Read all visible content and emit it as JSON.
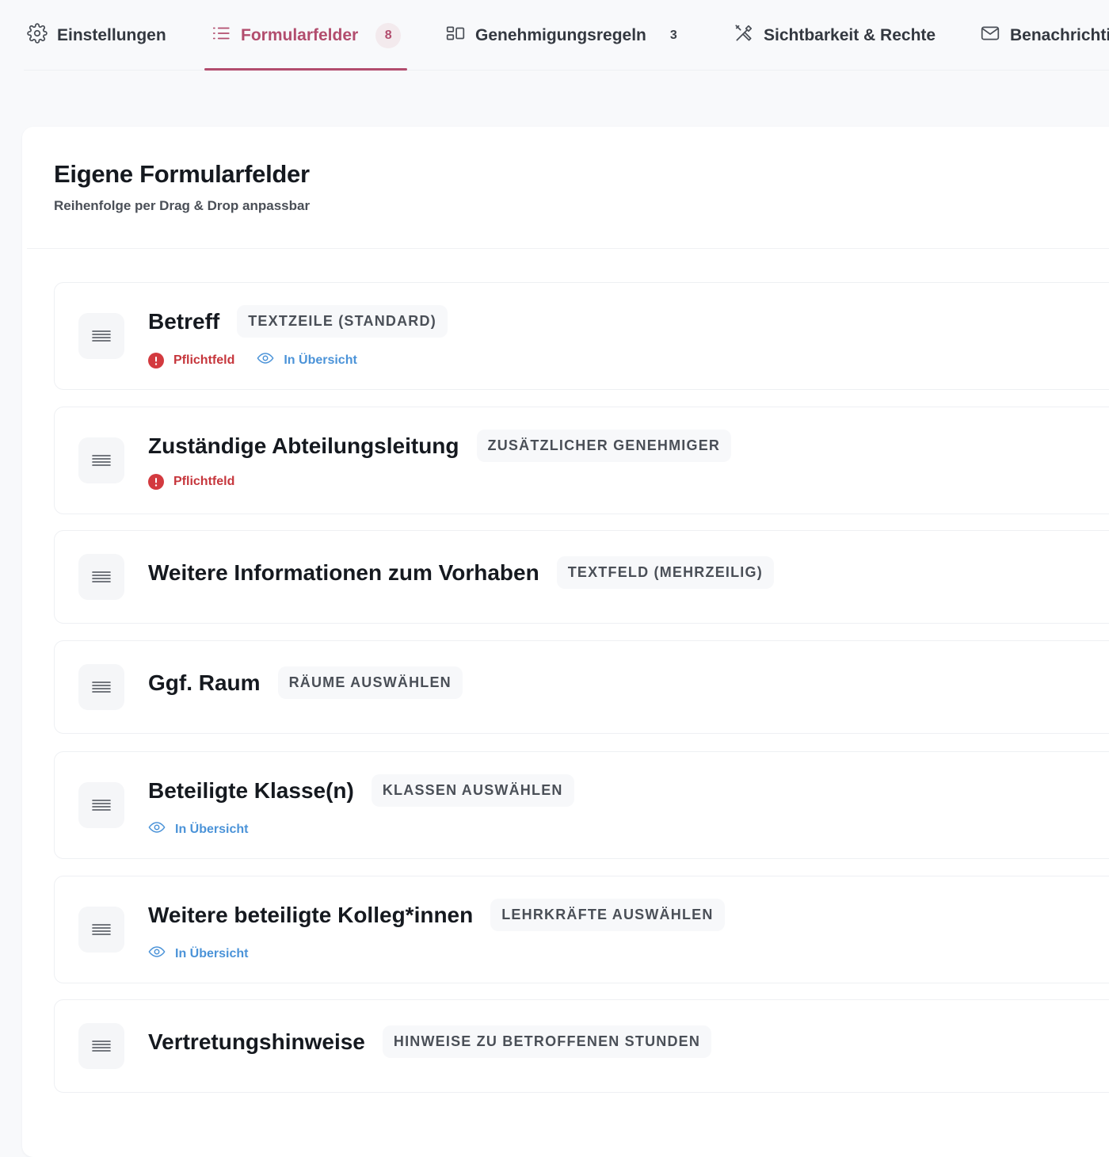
{
  "tabs": [
    {
      "label": "Einstellungen",
      "icon": "gear-icon"
    },
    {
      "label": "Formularfelder",
      "icon": "list-icon",
      "count": "8",
      "active": true
    },
    {
      "label": "Genehmigungsregeln",
      "icon": "rules-icon",
      "count": "3"
    },
    {
      "label": "Sichtbarkeit & Rechte",
      "icon": "tools-icon"
    },
    {
      "label": "Benachrichtigungen",
      "icon": "mail-icon"
    }
  ],
  "card": {
    "title": "Eigene Formularfelder",
    "subtitle": "Reihenfolge per Drag & Drop anpassbar"
  },
  "labels": {
    "required": "Pflichtfeld",
    "overview": "In Übersicht"
  },
  "fields": [
    {
      "name": "Betreff",
      "type": "TEXTZEILE (STANDARD)",
      "required": true,
      "overview": true
    },
    {
      "name": "Zuständige Abteilungsleitung",
      "type": "ZUSÄTZLICHER GENEHMIGER",
      "required": true,
      "overview": false
    },
    {
      "name": "Weitere Informationen zum Vorhaben",
      "type": "TEXTFELD (MEHRZEILIG)",
      "required": false,
      "overview": false
    },
    {
      "name": "Ggf. Raum",
      "type": "RÄUME AUSWÄHLEN",
      "required": false,
      "overview": false
    },
    {
      "name": "Beteiligte Klasse(n)",
      "type": "KLASSEN AUSWÄHLEN",
      "required": false,
      "overview": true
    },
    {
      "name": "Weitere beteiligte Kolleg*innen",
      "type": "LEHRKRÄFTE AUSWÄHLEN",
      "required": false,
      "overview": true
    },
    {
      "name": "Vertretungshinweise",
      "type": "HINWEISE ZU BETROFFENEN STUNDEN",
      "required": false,
      "overview": false
    }
  ],
  "colors": {
    "accent": "#b24d6e",
    "required": "#c6363c",
    "overview": "#4b93d8"
  }
}
